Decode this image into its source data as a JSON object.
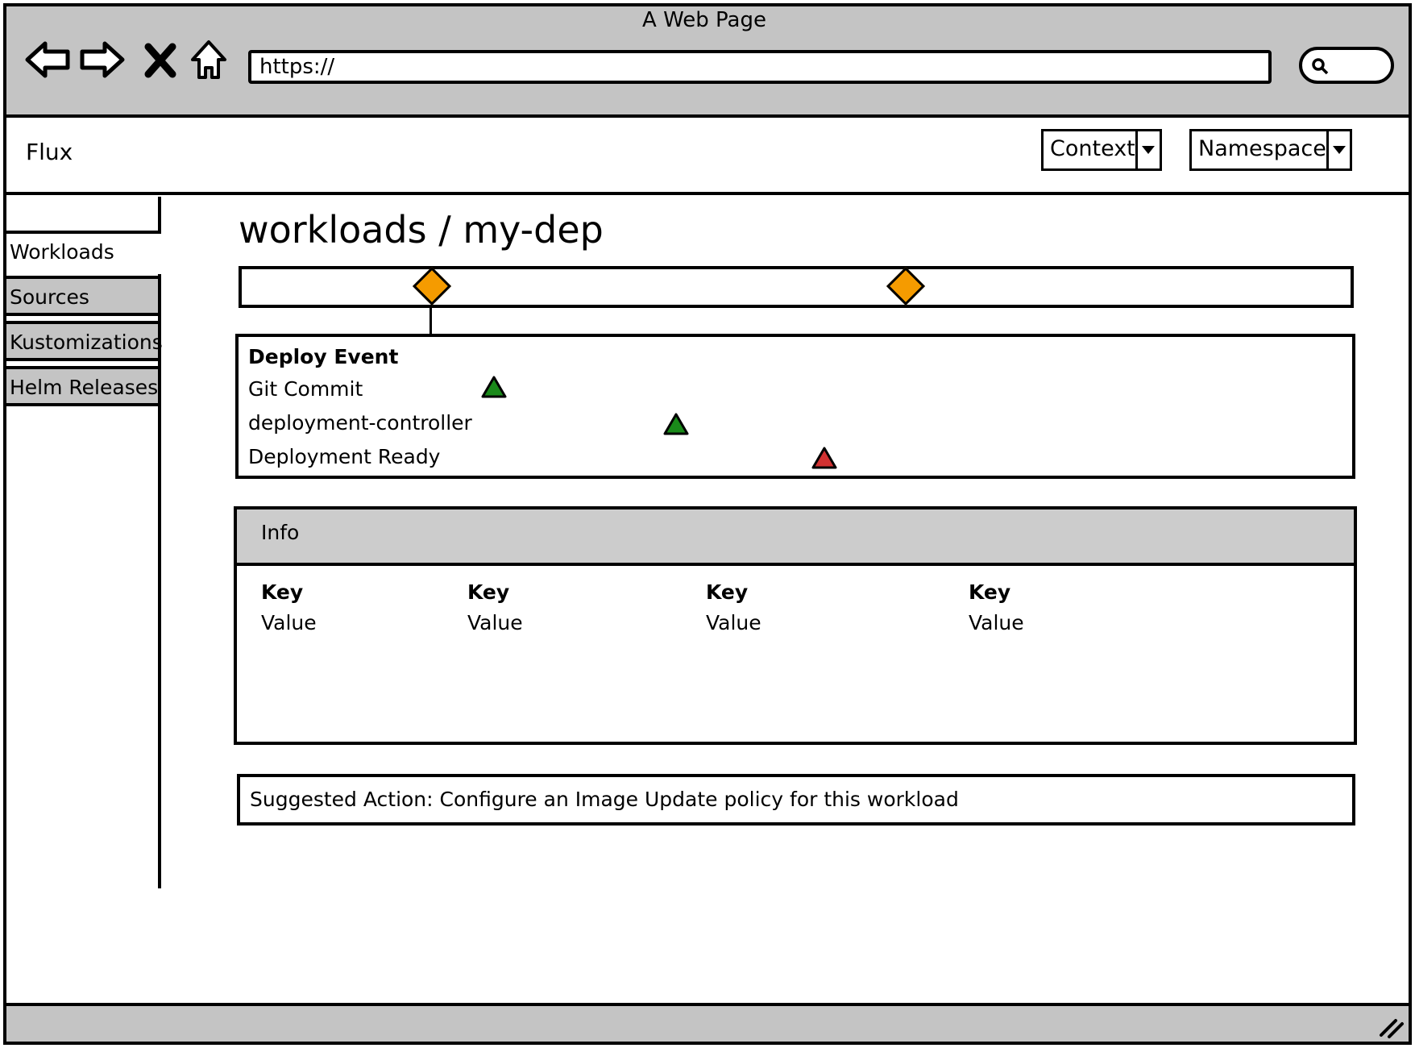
{
  "browser": {
    "title": "A Web Page",
    "url": "https://"
  },
  "app": {
    "name": "Flux",
    "context_label": "Context",
    "namespace_label": "Namespace"
  },
  "sidebar": {
    "items": [
      {
        "label": "Workloads",
        "active": true
      },
      {
        "label": "Sources",
        "active": false
      },
      {
        "label": "Kustomizations",
        "active": false
      },
      {
        "label": "Helm Releases",
        "active": false
      }
    ]
  },
  "main": {
    "title": "workloads / my-dep",
    "events": {
      "header": "Deploy Event",
      "rows": [
        {
          "label": "Git Commit",
          "status": "green"
        },
        {
          "label": "deployment-controller",
          "status": "green"
        },
        {
          "label": "Deployment Ready",
          "status": "red"
        }
      ]
    },
    "info": {
      "title": "Info",
      "pairs": [
        {
          "key": "Key",
          "value": "Value"
        },
        {
          "key": "Key",
          "value": "Value"
        },
        {
          "key": "Key",
          "value": "Value"
        },
        {
          "key": "Key",
          "value": "Value"
        }
      ]
    },
    "suggested_action": "Suggested Action: Configure an Image Update policy for this workload"
  },
  "colors": {
    "chrome_gray": "#c4c4c4",
    "marker_orange": "#f59b00",
    "status_green": "#1a8a1a",
    "status_red": "#d23232"
  }
}
